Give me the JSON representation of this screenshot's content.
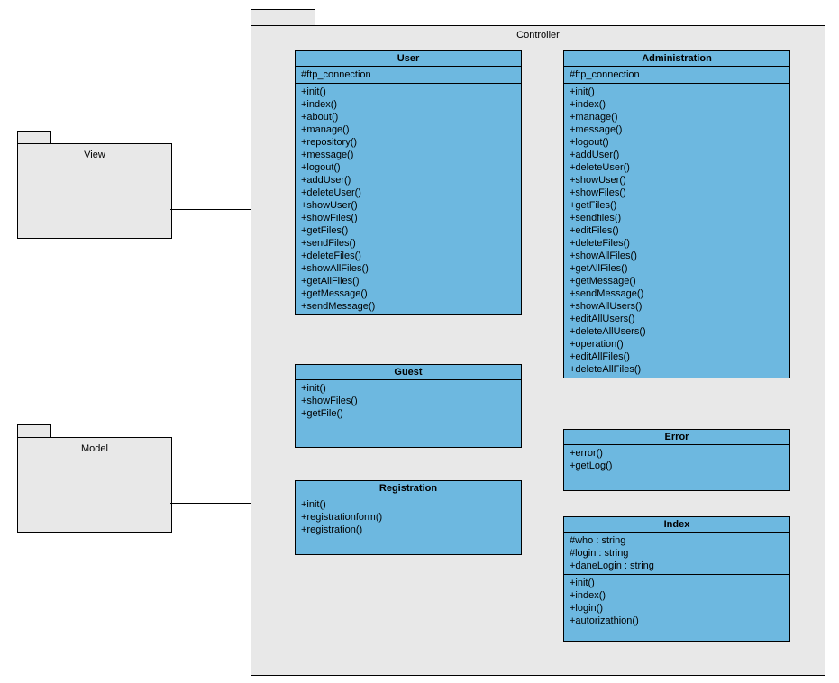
{
  "packages": {
    "view": {
      "label": "View"
    },
    "model": {
      "label": "Model"
    },
    "controller": {
      "label": "Controller"
    }
  },
  "classes": {
    "user": {
      "title": "User",
      "attrs": [
        "#ftp_connection"
      ],
      "methods": [
        "+init()",
        "+index()",
        "+about()",
        "+manage()",
        "+repository()",
        "+message()",
        "+logout()",
        "+addUser()",
        "+deleteUser()",
        "+showUser()",
        "+showFiles()",
        "+getFiles()",
        "+sendFiles()",
        "+deleteFiles()",
        "+showAllFiles()",
        "+getAllFiles()",
        "+getMessage()",
        "+sendMessage()"
      ]
    },
    "administration": {
      "title": "Administration",
      "attrs": [
        "#ftp_connection"
      ],
      "methods": [
        "+init()",
        "+index()",
        "+manage()",
        "+message()",
        "+logout()",
        "+addUser()",
        "+deleteUser()",
        "+showUser()",
        "+showFiles()",
        "+getFiles()",
        "+sendfiles()",
        "+editFiles()",
        "+deleteFiles()",
        "+showAllFiles()",
        "+getAllFiles()",
        "+getMessage()",
        "+sendMessage()",
        "+showAllUsers()",
        "+editAllUsers()",
        "+deleteAllUsers()",
        "+operation()",
        "+editAllFiles()",
        "+deleteAllFiles()"
      ]
    },
    "guest": {
      "title": "Guest",
      "attrs": [],
      "methods": [
        "+init()",
        "+showFiles()",
        "+getFile()"
      ]
    },
    "registration": {
      "title": "Registration",
      "attrs": [],
      "methods": [
        "+init()",
        "+registrationform()",
        "+registration()"
      ]
    },
    "error": {
      "title": "Error",
      "attrs": [],
      "methods": [
        "+error()",
        "+getLog()"
      ]
    },
    "index": {
      "title": "Index",
      "attrs": [
        "#who : string",
        "#login : string",
        "+daneLogin : string"
      ],
      "methods": [
        "+init()",
        "+index()",
        "+login()",
        "+autorizathion()"
      ]
    }
  }
}
